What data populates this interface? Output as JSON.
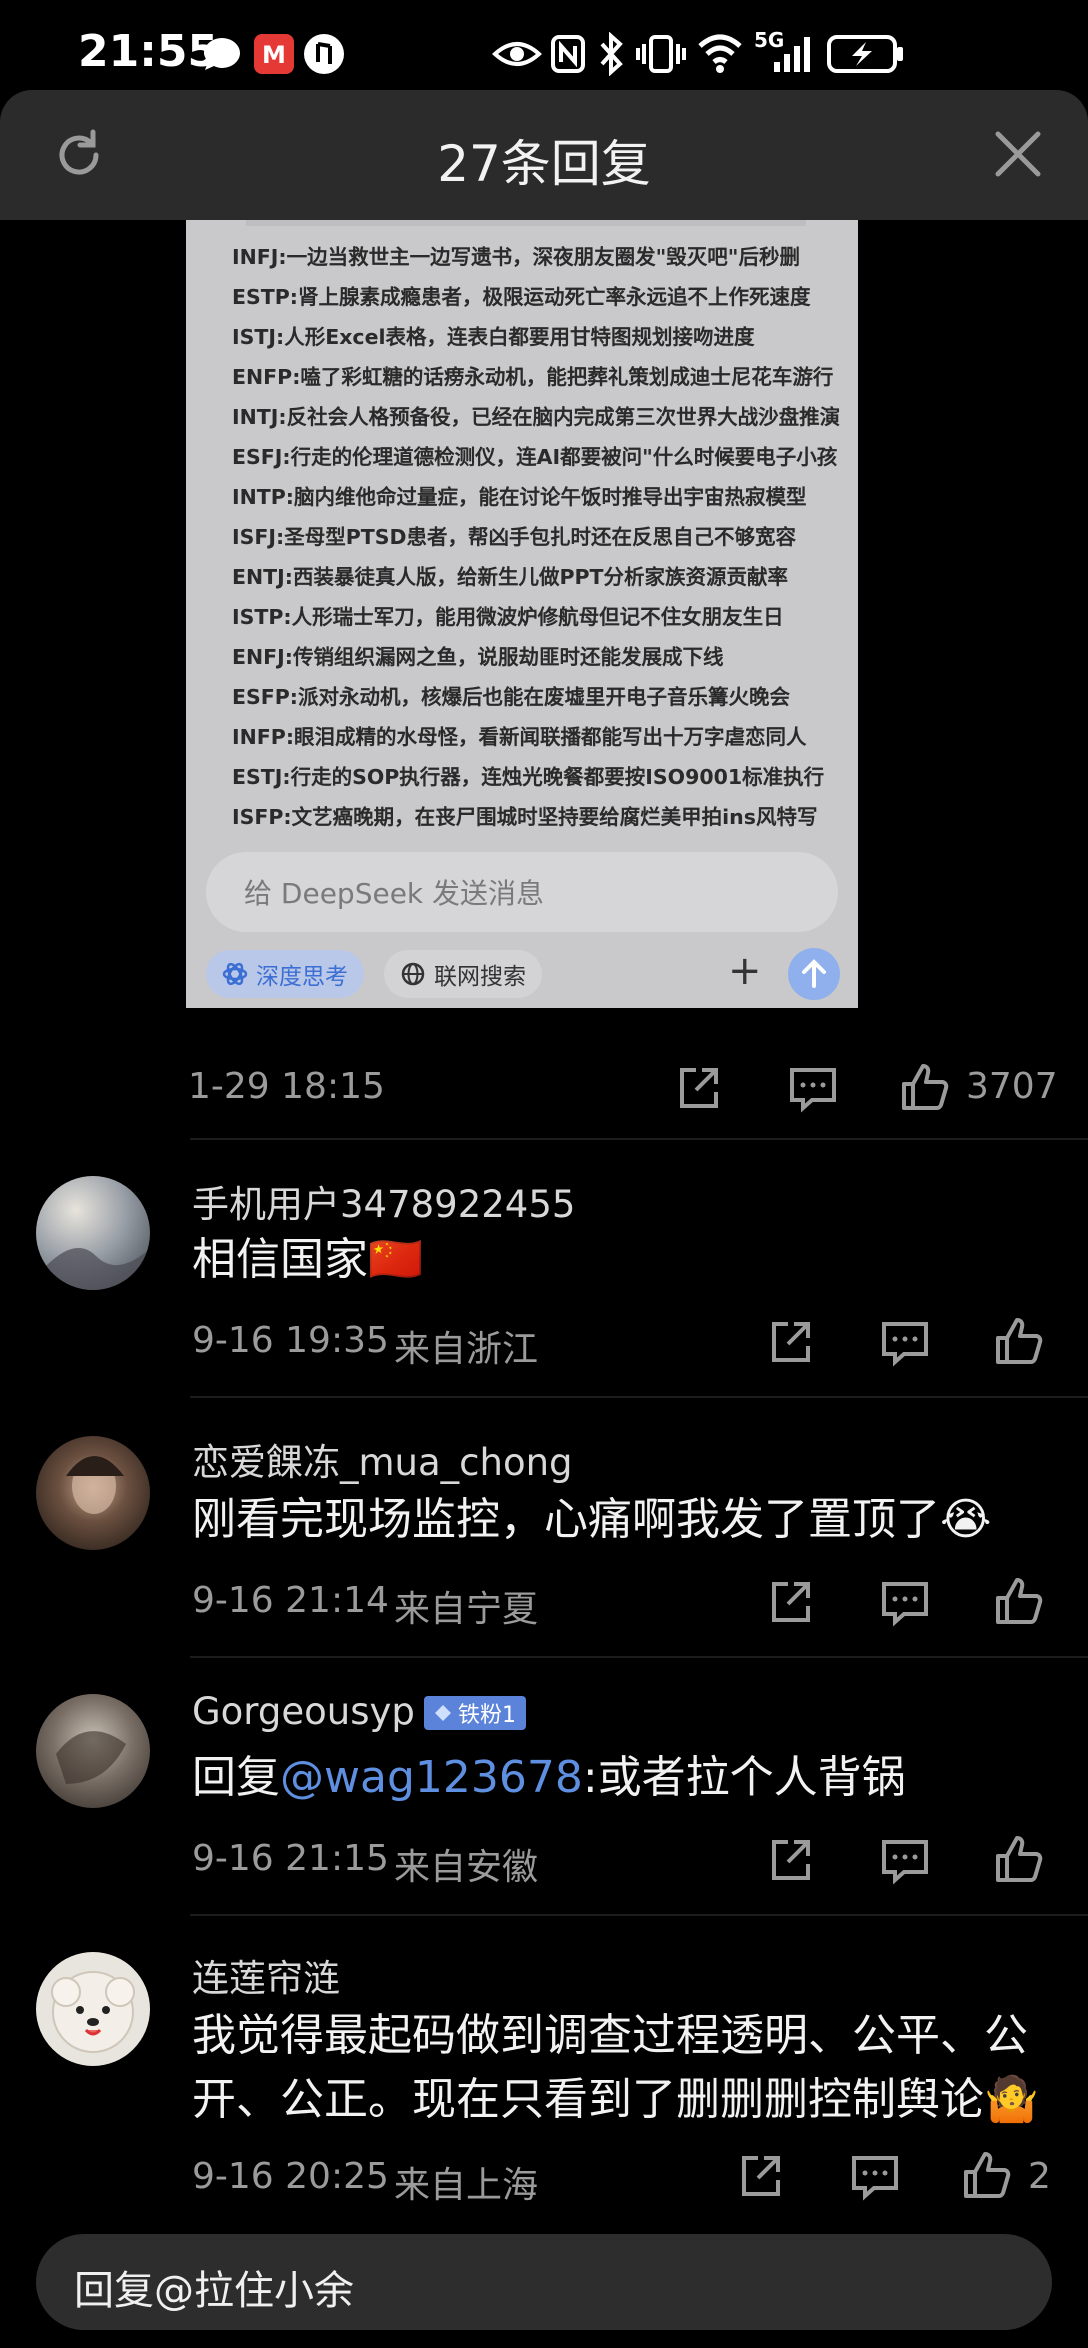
{
  "status_bar": {
    "time": "21:55",
    "network": "5G"
  },
  "header": {
    "title": "27条回复"
  },
  "screenshot_content": {
    "lines": [
      "INFJ:一边当救世主一边写遗书，深夜朋友圈发\"毁灭吧\"后秒删",
      "ESTP:肾上腺素成瘾患者，极限运动死亡率永远追不上作死速度",
      "ISTJ:人形Excel表格，连表白都要用甘特图规划接吻进度",
      "ENFP:嗑了彩虹糖的话痨永动机，能把葬礼策划成迪士尼花车游行",
      "INTJ:反社会人格预备役，已经在脑内完成第三次世界大战沙盘推演",
      "ESFJ:行走的伦理道德检测仪，连AI都要被问\"什么时候要电子小孩",
      "INTP:脑内维他命过量症，能在讨论午饭时推导出宇宙热寂模型",
      "ISFJ:圣母型PTSD患者，帮凶手包扎时还在反思自己不够宽容",
      "ENTJ:西装暴徒真人版，给新生儿做PPT分析家族资源贡献率",
      "ISTP:人形瑞士军刀，能用微波炉修航母但记不住女朋友生日",
      "ENFJ:传销组织漏网之鱼，说服劫匪时还能发展成下线",
      "ESFP:派对永动机，核爆后也能在废墟里开电子音乐篝火晚会",
      "INFP:眼泪成精的水母怪，看新闻联播都能写出十万字虐恋同人",
      "ESTJ:行走的SOP执行器，连烛光晚餐都要按ISO9001标准执行",
      "ISFP:文艺癌晚期，在丧尸围城时坚持要给腐烂美甲拍ins风特写"
    ],
    "input_placeholder": "给 DeepSeek 发送消息",
    "chip_deep": "深度思考",
    "chip_web": "联网搜索",
    "plus": "+"
  },
  "main_post": {
    "date": "1-29 18:15",
    "likes": "3707"
  },
  "comments": [
    {
      "username": "手机用户3478922455",
      "text": "相信国家🇨🇳",
      "time": "9-16 19:35",
      "location": "来自浙江",
      "likes": ""
    },
    {
      "username": "恋爱餜冻_mua_chong",
      "text": "刚看完现场监控，心痛啊我发了置顶了😭",
      "time": "9-16 21:14",
      "location": "来自宁夏",
      "likes": ""
    },
    {
      "username": "Gorgeousyp",
      "badge": "铁粉1",
      "reply_prefix": "回复",
      "mention": "@wag123678",
      "text": ":或者拉个人背锅",
      "time": "9-16 21:15",
      "location": "来自安徽",
      "likes": ""
    },
    {
      "username": "连莲帘涟",
      "text_line1": "我觉得最起码做到调查过程透明、公平、公",
      "text_line2": "开、公正。现在只看到了删删删控制舆论🤷",
      "time": "9-16 20:25",
      "location": "来自上海",
      "likes": "2"
    }
  ],
  "reply_bar": {
    "text": "回复@拉住小余"
  },
  "colors": {
    "background": "#000000",
    "header": "#2b2b2b",
    "mention": "#5f8fe0",
    "badge": "#5b83d9",
    "meta_text": "#9b9b9b"
  }
}
